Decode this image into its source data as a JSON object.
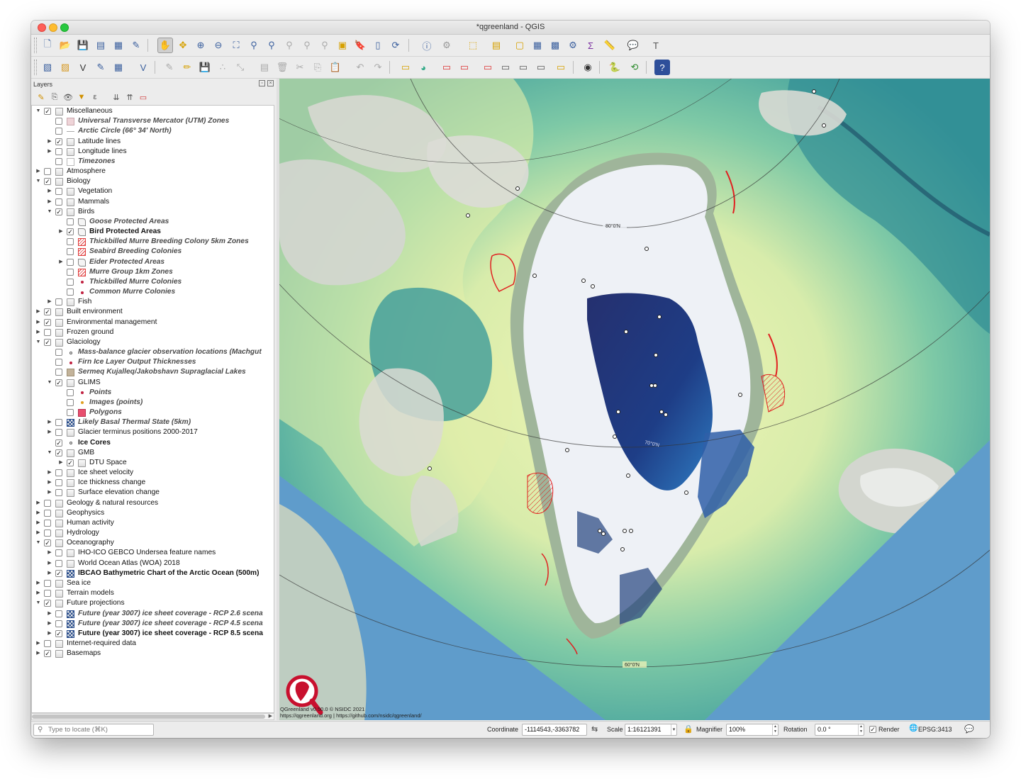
{
  "window": {
    "title": "*qgreenland - QGIS"
  },
  "layers_panel": {
    "title": "Layers",
    "tree": [
      {
        "label": "Miscellaneous",
        "depth": 0,
        "expanded": true,
        "checked": true,
        "icon": "group-icon",
        "style": "normal"
      },
      {
        "label": "Universal Transverse Mercator (UTM) Zones",
        "depth": 1,
        "expanded": null,
        "checked": false,
        "icon": "polygon-pink-icon",
        "style": "italic"
      },
      {
        "label": "Arctic Circle (66° 34' North)",
        "depth": 1,
        "expanded": null,
        "checked": false,
        "icon": "line-icon",
        "style": "italic"
      },
      {
        "label": "Latitude lines",
        "depth": 1,
        "expanded": false,
        "checked": true,
        "icon": "group-icon",
        "style": "normal"
      },
      {
        "label": "Longitude lines",
        "depth": 1,
        "expanded": false,
        "checked": false,
        "icon": "group-icon",
        "style": "normal"
      },
      {
        "label": "Timezones",
        "depth": 1,
        "expanded": null,
        "checked": false,
        "icon": "empty-polygon-icon",
        "style": "italic"
      },
      {
        "label": "Atmosphere",
        "depth": 0,
        "expanded": false,
        "checked": false,
        "icon": "group-icon",
        "style": "normal"
      },
      {
        "label": "Biology",
        "depth": 0,
        "expanded": true,
        "checked": true,
        "icon": "group-icon",
        "style": "normal"
      },
      {
        "label": "Vegetation",
        "depth": 1,
        "expanded": false,
        "checked": false,
        "icon": "group-icon",
        "style": "normal"
      },
      {
        "label": "Mammals",
        "depth": 1,
        "expanded": false,
        "checked": false,
        "icon": "group-icon",
        "style": "normal"
      },
      {
        "label": "Birds",
        "depth": 1,
        "expanded": true,
        "checked": true,
        "icon": "group-icon",
        "style": "normal"
      },
      {
        "label": "Goose Protected Areas",
        "depth": 2,
        "expanded": null,
        "checked": false,
        "icon": "outline-polygon-icon",
        "style": "italic"
      },
      {
        "label": "Bird Protected Areas",
        "depth": 2,
        "expanded": false,
        "checked": true,
        "icon": "outline-polygon-icon",
        "style": "bold"
      },
      {
        "label": "Thickbilled Murre Breeding Colony 5km Zones",
        "depth": 2,
        "expanded": null,
        "checked": false,
        "icon": "hatched-polygon-icon",
        "style": "italic"
      },
      {
        "label": "Seabird Breeding Colonies",
        "depth": 2,
        "expanded": null,
        "checked": false,
        "icon": "hatched-polygon-icon",
        "style": "italic"
      },
      {
        "label": "Eider Protected Areas",
        "depth": 2,
        "expanded": false,
        "checked": false,
        "icon": "outline-polygon-icon",
        "style": "italic"
      },
      {
        "label": "Murre Group 1km Zones",
        "depth": 2,
        "expanded": null,
        "checked": false,
        "icon": "hatched-polygon-icon",
        "style": "italic"
      },
      {
        "label": "Thickbilled Murre Colonies",
        "depth": 2,
        "expanded": null,
        "checked": false,
        "icon": "red-point-icon",
        "style": "italic"
      },
      {
        "label": "Common Murre Colonies",
        "depth": 2,
        "expanded": null,
        "checked": false,
        "icon": "red-point-icon",
        "style": "italic"
      },
      {
        "label": "Fish",
        "depth": 1,
        "expanded": false,
        "checked": false,
        "icon": "group-icon",
        "style": "normal"
      },
      {
        "label": "Built environment",
        "depth": 0,
        "expanded": false,
        "checked": true,
        "icon": "group-icon",
        "style": "normal"
      },
      {
        "label": "Environmental management",
        "depth": 0,
        "expanded": false,
        "checked": true,
        "icon": "group-icon",
        "style": "normal"
      },
      {
        "label": "Frozen ground",
        "depth": 0,
        "expanded": false,
        "checked": false,
        "icon": "group-icon",
        "style": "normal"
      },
      {
        "label": "Glaciology",
        "depth": 0,
        "expanded": true,
        "checked": true,
        "icon": "group-icon",
        "style": "normal"
      },
      {
        "label": "Mass-balance glacier observation locations (Machgut",
        "depth": 1,
        "expanded": null,
        "checked": false,
        "icon": "point-icon",
        "style": "italic"
      },
      {
        "label": "Firn Ice Layer Output Thicknesses",
        "depth": 1,
        "expanded": null,
        "checked": false,
        "icon": "red-point-icon",
        "style": "italic"
      },
      {
        "label": "Sermeq Kujalleq/Jakobshavn Supraglacial Lakes",
        "depth": 1,
        "expanded": null,
        "checked": false,
        "icon": "polygon-tan-icon",
        "style": "italic"
      },
      {
        "label": "GLIMS",
        "depth": 1,
        "expanded": true,
        "checked": true,
        "icon": "group-icon",
        "style": "normal"
      },
      {
        "label": "Points",
        "depth": 2,
        "expanded": null,
        "checked": false,
        "icon": "red-point-icon",
        "style": "italic"
      },
      {
        "label": "Images (points)",
        "depth": 2,
        "expanded": null,
        "checked": false,
        "icon": "yellow-point-icon",
        "style": "italic"
      },
      {
        "label": "Polygons",
        "depth": 2,
        "expanded": null,
        "checked": false,
        "icon": "polygon-red-icon",
        "style": "italic"
      },
      {
        "label": "Likely Basal Thermal State (5km)",
        "depth": 1,
        "expanded": false,
        "checked": false,
        "icon": "raster-icon",
        "style": "italic"
      },
      {
        "label": "Glacier terminus positions 2000-2017",
        "depth": 1,
        "expanded": false,
        "checked": false,
        "icon": "group-icon",
        "style": "normal"
      },
      {
        "label": "Ice Cores",
        "depth": 1,
        "expanded": null,
        "checked": true,
        "icon": "point-icon",
        "style": "bold"
      },
      {
        "label": "GMB",
        "depth": 1,
        "expanded": true,
        "checked": true,
        "icon": "group-icon",
        "style": "normal"
      },
      {
        "label": "DTU Space",
        "depth": 2,
        "expanded": false,
        "checked": true,
        "icon": "group-icon",
        "style": "normal"
      },
      {
        "label": "Ice sheet velocity",
        "depth": 1,
        "expanded": false,
        "checked": false,
        "icon": "group-icon",
        "style": "normal"
      },
      {
        "label": "Ice thickness change",
        "depth": 1,
        "expanded": false,
        "checked": false,
        "icon": "group-icon",
        "style": "normal"
      },
      {
        "label": "Surface elevation change",
        "depth": 1,
        "expanded": false,
        "checked": false,
        "icon": "group-icon",
        "style": "normal"
      },
      {
        "label": "Geology & natural resources",
        "depth": 0,
        "expanded": false,
        "checked": false,
        "icon": "group-icon",
        "style": "normal"
      },
      {
        "label": "Geophysics",
        "depth": 0,
        "expanded": false,
        "checked": false,
        "icon": "group-icon",
        "style": "normal"
      },
      {
        "label": "Human activity",
        "depth": 0,
        "expanded": false,
        "checked": false,
        "icon": "group-icon",
        "style": "normal"
      },
      {
        "label": "Hydrology",
        "depth": 0,
        "expanded": false,
        "checked": false,
        "icon": "group-icon",
        "style": "normal"
      },
      {
        "label": "Oceanography",
        "depth": 0,
        "expanded": true,
        "checked": true,
        "icon": "group-icon",
        "style": "normal"
      },
      {
        "label": "IHO-ICO GEBCO Undersea feature names",
        "depth": 1,
        "expanded": false,
        "checked": false,
        "icon": "group-icon",
        "style": "normal"
      },
      {
        "label": "World Ocean Atlas (WOA) 2018",
        "depth": 1,
        "expanded": false,
        "checked": false,
        "icon": "group-icon",
        "style": "normal"
      },
      {
        "label": "IBCAO Bathymetric Chart of the Arctic Ocean (500m)",
        "depth": 1,
        "expanded": false,
        "checked": true,
        "icon": "raster-icon",
        "style": "bold"
      },
      {
        "label": "Sea ice",
        "depth": 0,
        "expanded": false,
        "checked": false,
        "icon": "group-icon",
        "style": "normal"
      },
      {
        "label": "Terrain models",
        "depth": 0,
        "expanded": false,
        "checked": false,
        "icon": "group-icon",
        "style": "normal"
      },
      {
        "label": "Future projections",
        "depth": 0,
        "expanded": true,
        "checked": true,
        "icon": "group-icon",
        "style": "normal"
      },
      {
        "label": "Future (year 3007) ice sheet coverage - RCP 2.6 scena",
        "depth": 1,
        "expanded": false,
        "checked": false,
        "icon": "raster-icon",
        "style": "italic"
      },
      {
        "label": "Future (year 3007) ice sheet coverage - RCP 4.5 scena",
        "depth": 1,
        "expanded": false,
        "checked": false,
        "icon": "raster-icon",
        "style": "italic"
      },
      {
        "label": "Future (year 3007) ice sheet coverage - RCP 8.5 scena",
        "depth": 1,
        "expanded": false,
        "checked": true,
        "icon": "raster-icon",
        "style": "bold"
      },
      {
        "label": "Internet-required data",
        "depth": 0,
        "expanded": false,
        "checked": false,
        "icon": "group-icon",
        "style": "normal"
      },
      {
        "label": "Basemaps",
        "depth": 0,
        "expanded": false,
        "checked": true,
        "icon": "group-icon",
        "style": "normal"
      }
    ]
  },
  "map": {
    "lat_label_80": "80°0'N",
    "lat_label_70": "70°0'N",
    "lat_label_60": "60°0'N",
    "attribution_line1": "QGreenland v0.50.0 © NSIDC 2021",
    "attribution_line2": "https://qgreenland.org | https://github.com/nsidc/qgreenland/",
    "colors": {
      "ocean_basemap": "#6fa5cf",
      "ice_sheet": "#eef1f6",
      "shelf": "#eef3a8",
      "deep": "#1e5f7a",
      "ice_future": "#1f2a6e",
      "bird_areas": "#e02020"
    }
  },
  "statusbar": {
    "locator_placeholder": "Type to locate (⌘K)",
    "coordinate_label": "Coordinate",
    "coordinate_value": "-1114543,-3363782",
    "scale_label": "Scale",
    "scale_value": "1:16121391",
    "magnifier_label": "Magnifier",
    "magnifier_value": "100%",
    "rotation_label": "Rotation",
    "rotation_value": "0.0 °",
    "render_label": "Render",
    "render_checked": true,
    "crs": "EPSG:3413"
  }
}
